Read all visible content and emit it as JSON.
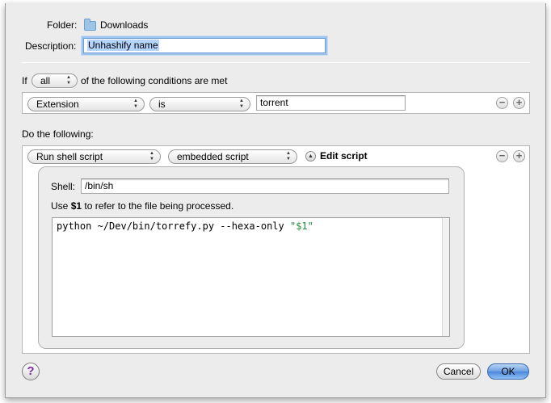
{
  "header": {
    "folder_label": "Folder:",
    "folder_name": "Downloads",
    "description_label": "Description:",
    "description_value": "Unhashify name"
  },
  "conditions": {
    "prefix": "If",
    "match_mode": "all",
    "suffix": "of the following conditions are met",
    "rows": [
      {
        "attribute": "Extension",
        "operator": "is",
        "value": "torrent"
      }
    ]
  },
  "actions": {
    "heading": "Do the following:",
    "rows": [
      {
        "action": "Run shell script",
        "script_mode": "embedded script",
        "edit_label": "Edit script",
        "shell_label": "Shell:",
        "shell_value": "/bin/sh",
        "hint_prefix": "Use ",
        "hint_var": "$1",
        "hint_suffix": " to refer to the file being processed.",
        "script_code": "python ~/Dev/bin/torrefy.py --hexa-only ",
        "script_string": "\"$1\""
      }
    ]
  },
  "footer": {
    "help_label": "?",
    "cancel_label": "Cancel",
    "ok_label": "OK"
  },
  "icons": {
    "remove": "−",
    "add": "+",
    "popup_arrows": "▲▼",
    "disclosure": "▲"
  }
}
